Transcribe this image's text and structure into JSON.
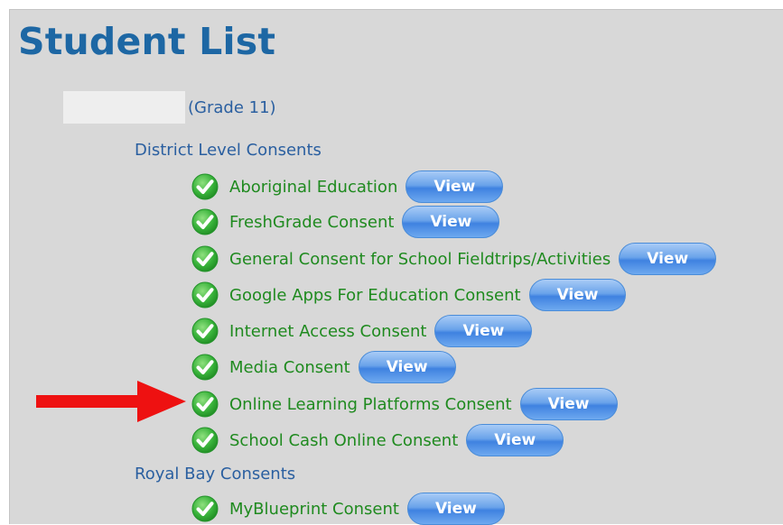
{
  "page": {
    "title": "Student List"
  },
  "student": {
    "grade_label": "(Grade 11)"
  },
  "groups": [
    {
      "heading": "District Level Consents",
      "items": [
        {
          "label": "Aboriginal Education",
          "button": "View",
          "status": "accepted"
        },
        {
          "label": "FreshGrade Consent",
          "button": "View",
          "status": "accepted"
        },
        {
          "label": "General Consent for School Fieldtrips/Activities",
          "button": "View",
          "status": "accepted"
        },
        {
          "label": "Google Apps For Education Consent",
          "button": "View",
          "status": "accepted"
        },
        {
          "label": "Internet Access Consent",
          "button": "View",
          "status": "accepted"
        },
        {
          "label": "Media Consent",
          "button": "View",
          "status": "accepted"
        },
        {
          "label": "Online Learning Platforms Consent",
          "button": "View",
          "status": "accepted",
          "highlighted": true
        },
        {
          "label": "School Cash Online Consent",
          "button": "View",
          "status": "accepted"
        }
      ]
    },
    {
      "heading": "Royal Bay Consents",
      "items": [
        {
          "label": "MyBlueprint Consent",
          "button": "View",
          "status": "accepted"
        }
      ]
    }
  ],
  "colors": {
    "title": "#1d67a4",
    "link": "#2a5fa0",
    "consent_text": "#1f8a1f",
    "check": "#2fae2f",
    "button": "#4d8fe6",
    "arrow": "#ee1111",
    "panel": "#d8d8d8"
  },
  "icons": {
    "status": "green-check-circle-icon",
    "pointer": "red-arrow-icon"
  }
}
